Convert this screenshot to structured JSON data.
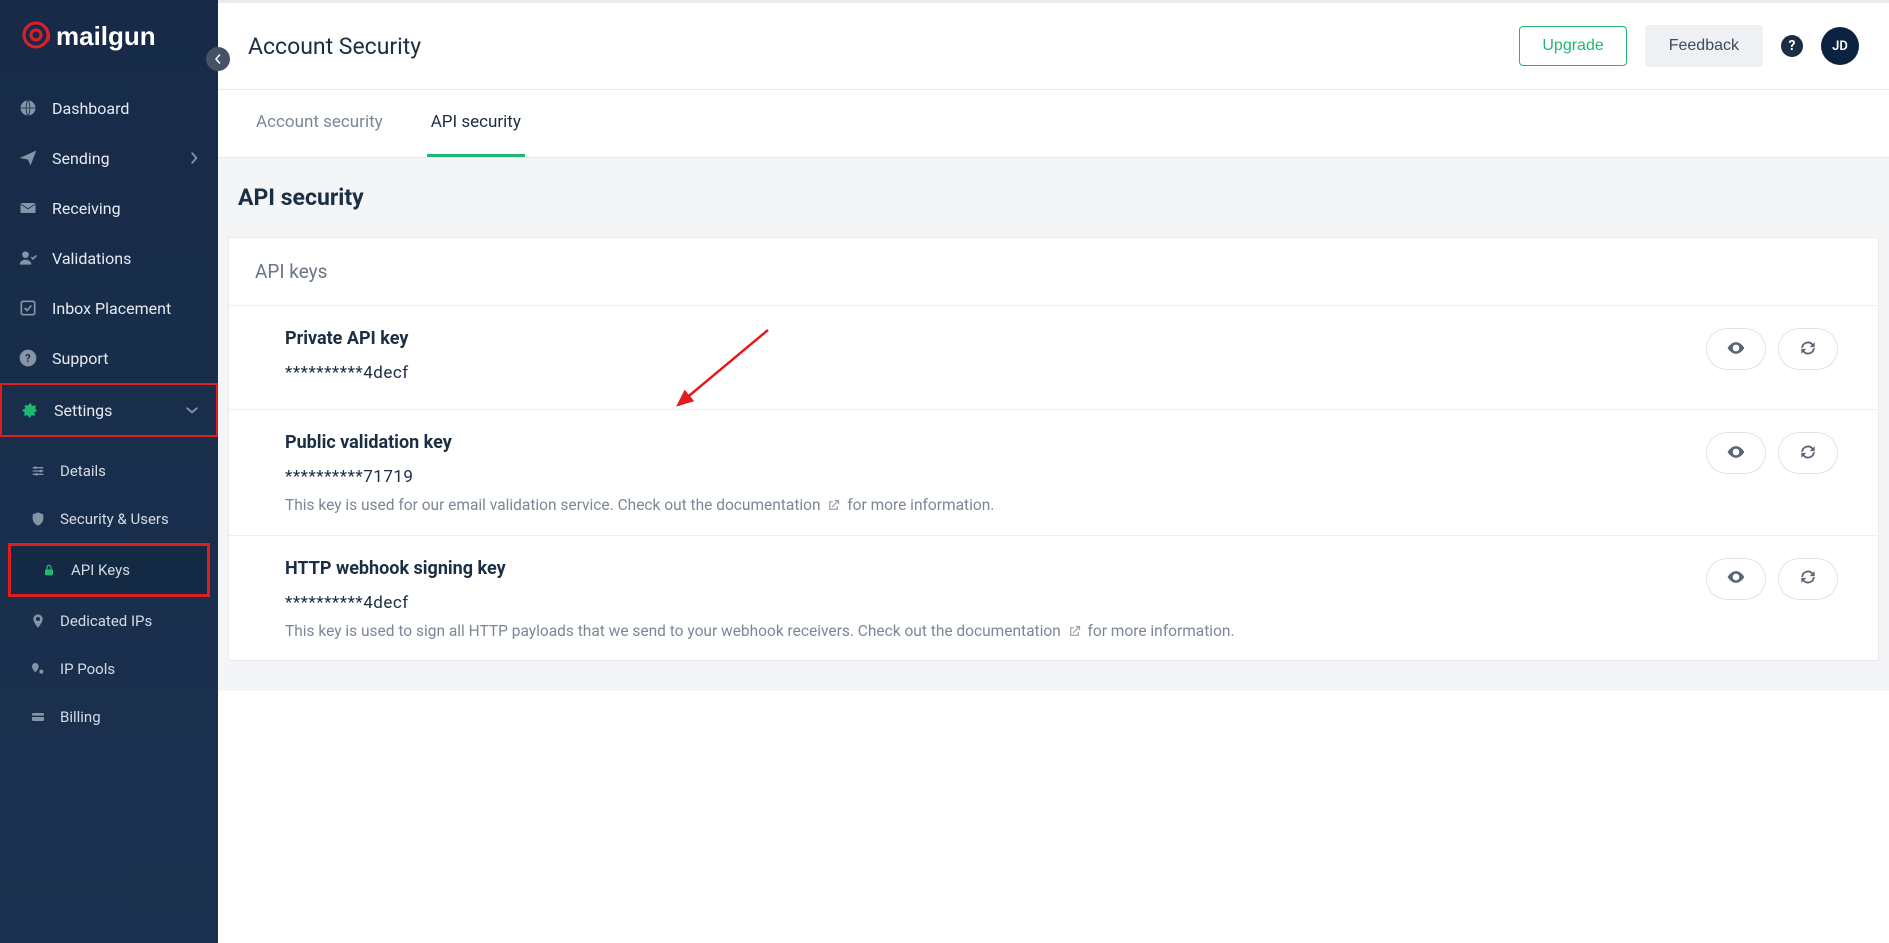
{
  "brand": {
    "name": "mailgun"
  },
  "header": {
    "title": "Account Security",
    "upgrade": "Upgrade",
    "feedback": "Feedback",
    "avatar_initials": "JD"
  },
  "sidebar": {
    "items": [
      {
        "label": "Dashboard"
      },
      {
        "label": "Sending"
      },
      {
        "label": "Receiving"
      },
      {
        "label": "Validations"
      },
      {
        "label": "Inbox Placement"
      },
      {
        "label": "Support"
      },
      {
        "label": "Settings"
      }
    ],
    "settings_sub": [
      {
        "label": "Details"
      },
      {
        "label": "Security & Users"
      },
      {
        "label": "API Keys"
      },
      {
        "label": "Dedicated IPs"
      },
      {
        "label": "IP Pools"
      },
      {
        "label": "Billing"
      }
    ]
  },
  "tabs": {
    "account_security": "Account security",
    "api_security": "API security"
  },
  "section": {
    "title": "API security",
    "panel_title": "API keys"
  },
  "keys": [
    {
      "name": "Private API key",
      "value": "**********4decf",
      "desc_pre": "",
      "desc_link": "",
      "desc_post": ""
    },
    {
      "name": "Public validation key",
      "value": "**********71719",
      "desc_pre": "This key is used for our email validation service. Check out the documentation ",
      "desc_post": " for more information."
    },
    {
      "name": "HTTP webhook signing key",
      "value": "**********4decf",
      "desc_pre": "This key is used to sign all HTTP payloads that we send to your webhook receivers. Check out the documentation ",
      "desc_post": " for more information."
    }
  ]
}
